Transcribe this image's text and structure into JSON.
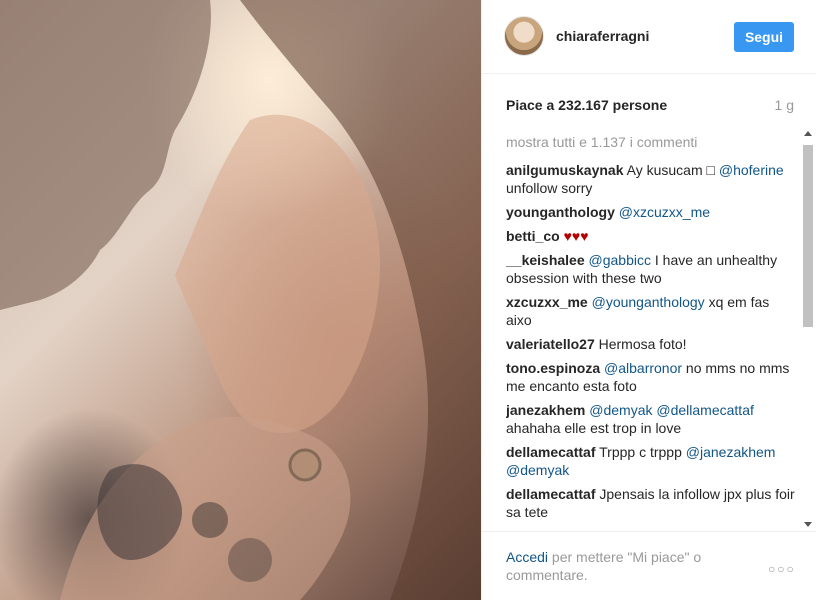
{
  "post": {
    "photo_icon": "photo-image",
    "author": {
      "username": "chiaraferragni",
      "avatar_icon": "avatar-image"
    },
    "follow_label": "Segui",
    "likes_text": "Piace a 232.167 persone",
    "time_ago": "1 g"
  },
  "comments": {
    "view_all": "mostra tutti e 1.137 i commenti",
    "items": [
      {
        "user": "anilgumuskaynak",
        "parts": [
          {
            "t": "Ay kusucam "
          },
          {
            "t": "□ "
          },
          {
            "m": "@hoferine"
          },
          {
            "t": " unfollow sorry"
          }
        ]
      },
      {
        "user": "younganthology",
        "parts": [
          {
            "m": "@xzcuzxx_me"
          }
        ]
      },
      {
        "user": "betti_co",
        "parts": [
          {
            "h": "♥♥♥"
          }
        ]
      },
      {
        "user": "__keishalee",
        "parts": [
          {
            "m": "@gabbicc"
          },
          {
            "t": " I have an unhealthy obsession with these two"
          }
        ]
      },
      {
        "user": "xzcuzxx_me",
        "parts": [
          {
            "m": "@younganthology"
          },
          {
            "t": " xq em fas aixo"
          }
        ]
      },
      {
        "user": "valeriatello27",
        "parts": [
          {
            "t": "Hermosa foto!"
          }
        ]
      },
      {
        "user": "tono.espinoza",
        "parts": [
          {
            "m": "@albarronor"
          },
          {
            "t": " no mms no mms me encanto esta foto"
          }
        ]
      },
      {
        "user": "janezakhem",
        "parts": [
          {
            "m": "@demyak"
          },
          {
            "t": " "
          },
          {
            "m": "@dellamecattaf"
          },
          {
            "t": " ahahaha elle est trop in love"
          }
        ]
      },
      {
        "user": "dellamecattaf",
        "parts": [
          {
            "t": "Trppp c trppp "
          },
          {
            "m": "@janezakhem"
          },
          {
            "t": " "
          },
          {
            "m": "@demyak"
          }
        ]
      },
      {
        "user": "dellamecattaf",
        "parts": [
          {
            "t": "Jpensais la infollow jpx plus foir sa tete"
          }
        ]
      }
    ]
  },
  "footer": {
    "login_link": "Accedi",
    "login_text": " per mettere \"Mi piace\" o commentare.",
    "more_icon": "more-options"
  },
  "colors": {
    "accent": "#3897f0",
    "mention": "#125688",
    "muted": "#999999",
    "heart": "#b60000"
  }
}
